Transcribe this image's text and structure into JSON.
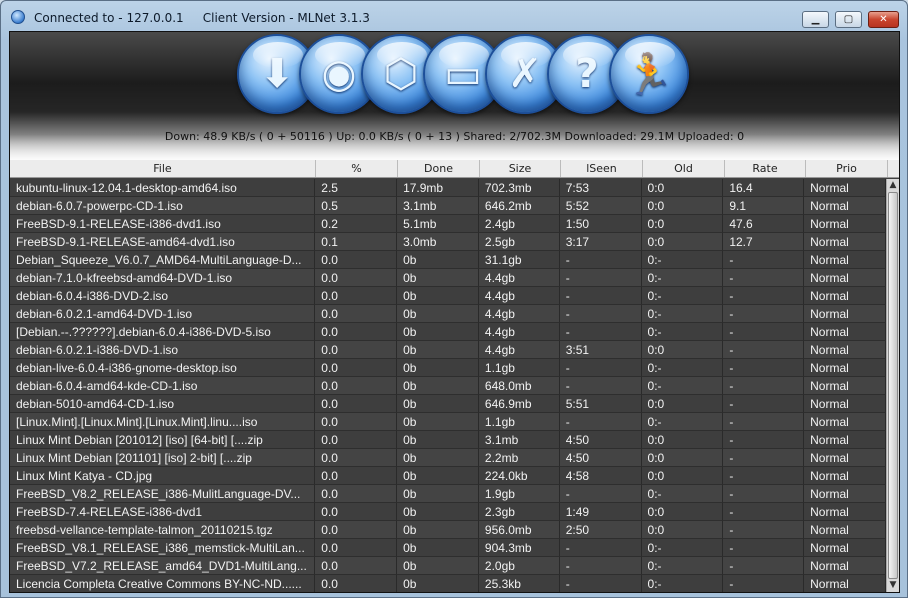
{
  "window": {
    "title": "Connected to - 127.0.0.1     Client Version - MLNet 3.1.3",
    "minimize_label": "▁",
    "maximize_label": "▢",
    "close_label": "✕"
  },
  "toolbar": {
    "buttons": [
      {
        "name": "downloads-icon",
        "glyph": "⬇"
      },
      {
        "name": "servers-icon",
        "glyph": "◉"
      },
      {
        "name": "search-icon",
        "glyph": "⬡"
      },
      {
        "name": "statistics-icon",
        "glyph": "▭"
      },
      {
        "name": "options-icon",
        "glyph": "✗"
      },
      {
        "name": "help-icon",
        "glyph": "?"
      },
      {
        "name": "exit-icon",
        "glyph": "🏃"
      }
    ]
  },
  "status": {
    "text": "Down: 48.9 KB/s ( 0 + 50116 )  Up: 0.0 KB/s ( 0 + 13 )  Shared: 2/702.3M  Downloaded: 29.1M  Uploaded: 0"
  },
  "table": {
    "columns": [
      "File",
      "%",
      "Done",
      "Size",
      "lSeen",
      "Old",
      "Rate",
      "Prio"
    ],
    "rows": [
      [
        "kubuntu-linux-12.04.1-desktop-amd64.iso",
        "2.5",
        "17.9mb",
        "702.3mb",
        "7:53",
        "0:0",
        "16.4",
        "Normal"
      ],
      [
        "debian-6.0.7-powerpc-CD-1.iso",
        "0.5",
        "3.1mb",
        "646.2mb",
        "5:52",
        "0:0",
        "9.1",
        "Normal"
      ],
      [
        "FreeBSD-9.1-RELEASE-i386-dvd1.iso",
        "0.2",
        "5.1mb",
        "2.4gb",
        "1:50",
        "0:0",
        "47.6",
        "Normal"
      ],
      [
        "FreeBSD-9.1-RELEASE-amd64-dvd1.iso",
        "0.1",
        "3.0mb",
        "2.5gb",
        "3:17",
        "0:0",
        "12.7",
        "Normal"
      ],
      [
        "Debian_Squeeze_V6.0.7_AMD64-MultiLanguage-D...",
        "0.0",
        "0b",
        "31.1gb",
        "-",
        "0:-",
        "-",
        "Normal"
      ],
      [
        "debian-7.1.0-kfreebsd-amd64-DVD-1.iso",
        "0.0",
        "0b",
        "4.4gb",
        "-",
        "0:-",
        "-",
        "Normal"
      ],
      [
        "debian-6.0.4-i386-DVD-2.iso",
        "0.0",
        "0b",
        "4.4gb",
        "-",
        "0:-",
        "-",
        "Normal"
      ],
      [
        "debian-6.0.2.1-amd64-DVD-1.iso",
        "0.0",
        "0b",
        "4.4gb",
        "-",
        "0:-",
        "-",
        "Normal"
      ],
      [
        "[Debian.--.??????].debian-6.0.4-i386-DVD-5.iso",
        "0.0",
        "0b",
        "4.4gb",
        "-",
        "0:-",
        "-",
        "Normal"
      ],
      [
        "debian-6.0.2.1-i386-DVD-1.iso",
        "0.0",
        "0b",
        "4.4gb",
        "3:51",
        "0:0",
        "-",
        "Normal"
      ],
      [
        "debian-live-6.0.4-i386-gnome-desktop.iso",
        "0.0",
        "0b",
        "1.1gb",
        "-",
        "0:-",
        "-",
        "Normal"
      ],
      [
        "debian-6.0.4-amd64-kde-CD-1.iso",
        "0.0",
        "0b",
        "648.0mb",
        "-",
        "0:-",
        "-",
        "Normal"
      ],
      [
        "debian-5010-amd64-CD-1.iso",
        "0.0",
        "0b",
        "646.9mb",
        "5:51",
        "0:0",
        "-",
        "Normal"
      ],
      [
        "[Linux.Mint].[Linux.Mint].[Linux.Mint].linu....iso",
        "0.0",
        "0b",
        "1.1gb",
        "-",
        "0:-",
        "-",
        "Normal"
      ],
      [
        "Linux Mint Debian [201012] [iso] [64-bit] [....zip",
        "0.0",
        "0b",
        "3.1mb",
        "4:50",
        "0:0",
        "-",
        "Normal"
      ],
      [
        "Linux Mint Debian [201101] [iso] 2-bit] [....zip",
        "0.0",
        "0b",
        "2.2mb",
        "4:50",
        "0:0",
        "-",
        "Normal"
      ],
      [
        "Linux Mint Katya - CD.jpg",
        "0.0",
        "0b",
        "224.0kb",
        "4:58",
        "0:0",
        "-",
        "Normal"
      ],
      [
        "FreeBSD_V8.2_RELEASE_i386-MulitLanguage-DV...",
        "0.0",
        "0b",
        "1.9gb",
        "-",
        "0:-",
        "-",
        "Normal"
      ],
      [
        "FreeBSD-7.4-RELEASE-i386-dvd1",
        "0.0",
        "0b",
        "2.3gb",
        "1:49",
        "0:0",
        "-",
        "Normal"
      ],
      [
        "freebsd-vellance-template-talmon_20110215.tgz",
        "0.0",
        "0b",
        "956.0mb",
        "2:50",
        "0:0",
        "-",
        "Normal"
      ],
      [
        "FreeBSD_V8.1_RELEASE_i386_memstick-MultiLan...",
        "0.0",
        "0b",
        "904.3mb",
        "-",
        "0:-",
        "-",
        "Normal"
      ],
      [
        "FreeBSD_V7.2_RELEASE_amd64_DVD1-MultiLang...",
        "0.0",
        "0b",
        "2.0gb",
        "-",
        "0:-",
        "-",
        "Normal"
      ],
      [
        "Licencia Completa Creative Commons BY-NC-ND......",
        "0.0",
        "0b",
        "25.3kb",
        "-",
        "0:-",
        "-",
        "Normal"
      ]
    ]
  }
}
